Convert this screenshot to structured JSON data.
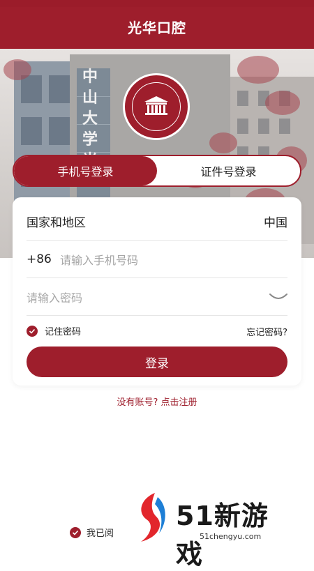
{
  "header": {
    "title": "光华口腔"
  },
  "hero": {
    "sign_chars": [
      "中",
      "山",
      "大",
      "学",
      "光"
    ],
    "logo_alt": "中山大学 附属口腔医院"
  },
  "tabs": [
    {
      "label": "手机号登录",
      "active": true
    },
    {
      "label": "证件号登录",
      "active": false
    }
  ],
  "form": {
    "region_label": "国家和地区",
    "region_value": "中国",
    "phone_prefix": "+86",
    "phone_placeholder": "请输入手机号码",
    "password_placeholder": "请输入密码",
    "remember_label": "记住密码",
    "forgot_label": "忘记密码?",
    "login_label": "登录"
  },
  "register_link": "没有账号? 点击注册",
  "agreement_prefix": "我已阅",
  "watermark": {
    "brand": "51新游戏",
    "url": "51chengyu.com"
  },
  "colors": {
    "primary": "#9e1e2c",
    "placeholder": "#a6a6a6"
  }
}
